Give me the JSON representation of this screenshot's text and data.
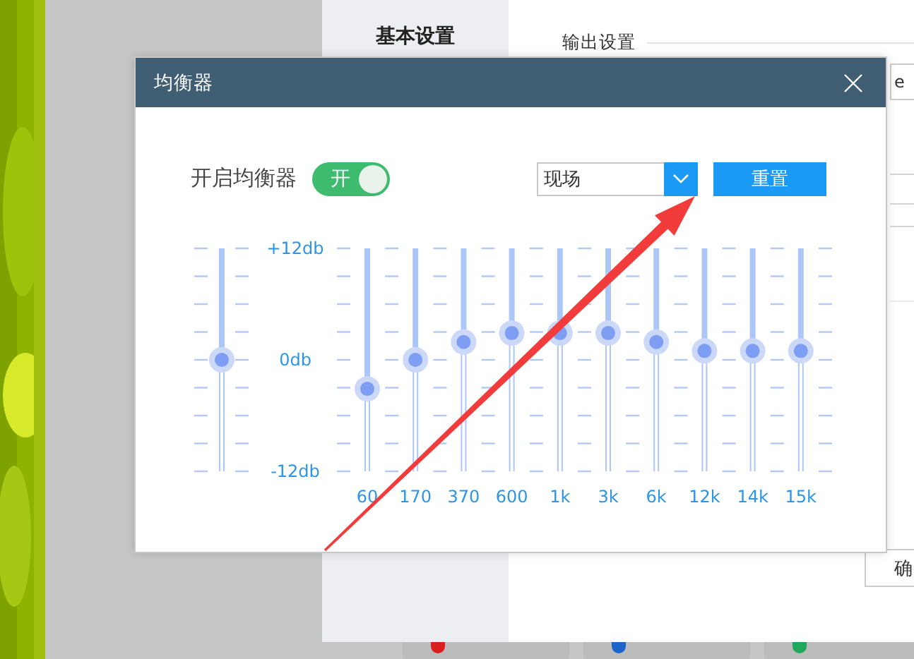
{
  "settings_window": {
    "sidebar": {
      "items": [
        {
          "label": "基本设置"
        }
      ]
    },
    "section_title": "输出设置",
    "field_value": "e",
    "confirm_button": "确"
  },
  "dialog": {
    "title": "均衡器",
    "enable": {
      "label": "开启均衡器",
      "on": true,
      "state_text": "开"
    },
    "preset": {
      "value": "现场"
    },
    "reset_button": "重置",
    "preamp": {
      "level": 0.5
    },
    "scale_labels": [
      "+12db",
      "0db",
      "-12db"
    ],
    "bands": [
      {
        "label": "60",
        "level": 0.37
      },
      {
        "label": "170",
        "level": 0.5
      },
      {
        "label": "370",
        "level": 0.58
      },
      {
        "label": "600",
        "level": 0.62
      },
      {
        "label": "1k",
        "level": 0.62
      },
      {
        "label": "3k",
        "level": 0.62
      },
      {
        "label": "6k",
        "level": 0.58
      },
      {
        "label": "12k",
        "level": 0.54
      },
      {
        "label": "14k",
        "level": 0.54
      },
      {
        "label": "15k",
        "level": 0.54
      }
    ]
  },
  "annotation": {
    "kind": "arrow"
  }
}
